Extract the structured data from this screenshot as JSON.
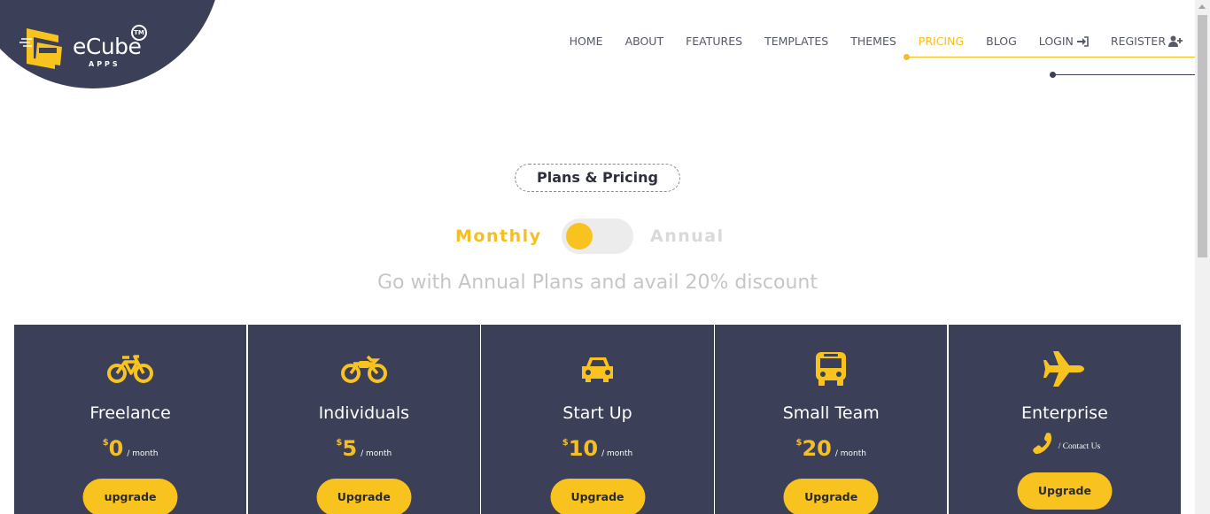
{
  "brand": {
    "name": "eCube",
    "sub": "APPS",
    "tm": "TM"
  },
  "nav": {
    "items": [
      {
        "label": "HOME",
        "active": false
      },
      {
        "label": "ABOUT",
        "active": false
      },
      {
        "label": "FEATURES",
        "active": false
      },
      {
        "label": "TEMPLATES",
        "active": false
      },
      {
        "label": "THEMES",
        "active": false
      },
      {
        "label": "PRICING",
        "active": true
      },
      {
        "label": "BLOG",
        "active": false
      },
      {
        "label": "LOGIN",
        "active": false,
        "icon": "sign-in-icon"
      },
      {
        "label": "REGISTER",
        "active": false,
        "icon": "user-plus-icon"
      }
    ]
  },
  "section": {
    "badge": "Plans & Pricing",
    "toggle": {
      "left": "Monthly",
      "right": "Annual",
      "selected": "Monthly"
    },
    "discount": "Go with Annual Plans and avail 20% discount"
  },
  "plans": [
    {
      "name": "Freelance",
      "icon": "bicycle-icon",
      "currency": "$",
      "price": "0",
      "period": "/ month",
      "button": "upgrade"
    },
    {
      "name": "Individuals",
      "icon": "motorcycle-icon",
      "currency": "$",
      "price": "5",
      "period": "/ month",
      "button": "Upgrade"
    },
    {
      "name": "Start Up",
      "icon": "car-icon",
      "currency": "$",
      "price": "10",
      "period": "/ month",
      "button": "Upgrade"
    },
    {
      "name": "Small Team",
      "icon": "bus-icon",
      "currency": "$",
      "price": "20",
      "period": "/ month",
      "button": "Upgrade"
    },
    {
      "name": "Enterprise",
      "icon": "plane-icon",
      "contact": "/ Contact Us",
      "contact_icon": "phone-icon",
      "button": "Upgrade"
    }
  ],
  "colors": {
    "accent": "#f4bf24",
    "card_bg": "#3b3f57",
    "text_dark": "#2c2f3c"
  }
}
